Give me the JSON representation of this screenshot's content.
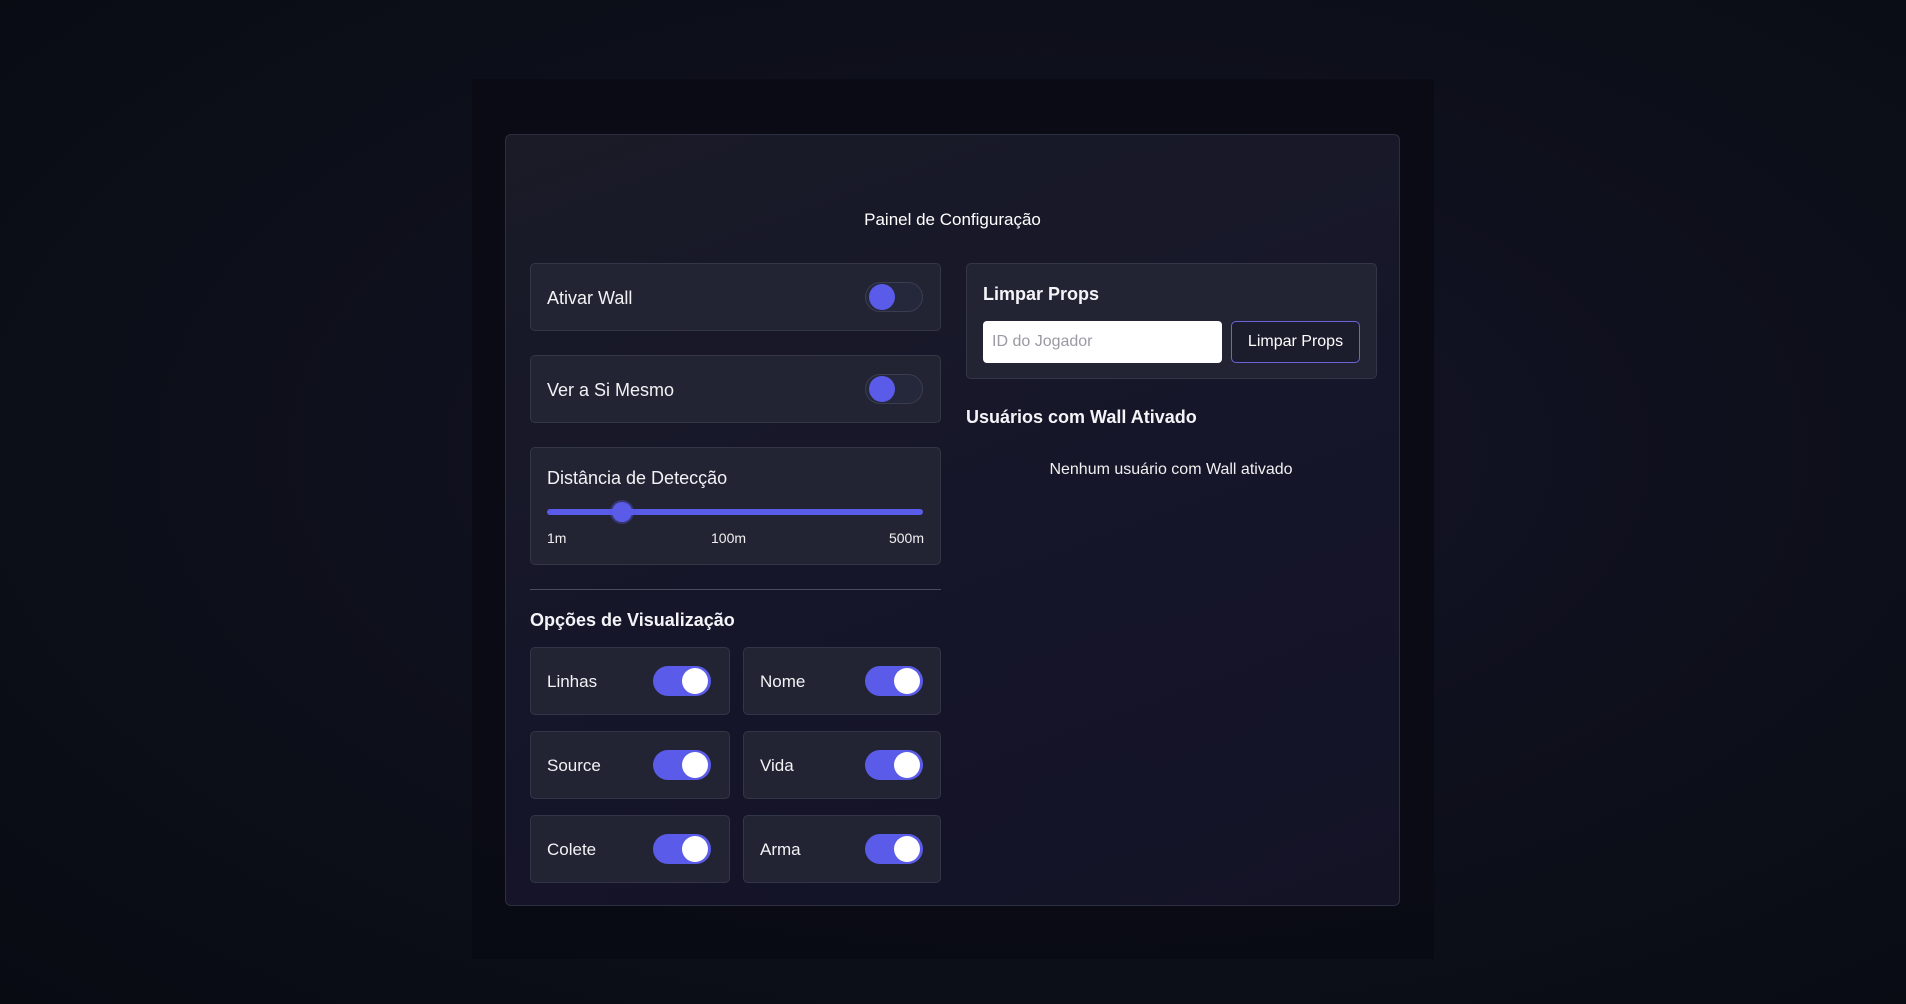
{
  "panel": {
    "title": "Painel de Configuração"
  },
  "settings": {
    "wall": {
      "label": "Ativar Wall",
      "enabled": false
    },
    "self_view": {
      "label": "Ver a Si Mesmo",
      "enabled": false
    },
    "distance": {
      "label": "Distância de Detecção",
      "min_label": "1m",
      "mid_label": "100m",
      "max_label": "500m",
      "min": 1,
      "max": 500,
      "value": 100
    }
  },
  "visual_options": {
    "title": "Opções de Visualização",
    "items": [
      {
        "label": "Linhas",
        "enabled": true
      },
      {
        "label": "Nome",
        "enabled": true
      },
      {
        "label": "Source",
        "enabled": true
      },
      {
        "label": "Vida",
        "enabled": true
      },
      {
        "label": "Colete",
        "enabled": true
      },
      {
        "label": "Arma",
        "enabled": true
      }
    ]
  },
  "clear_props": {
    "title": "Limpar Props",
    "input_placeholder": "ID do Jogador",
    "input_value": "",
    "button_label": "Limpar Props"
  },
  "wall_users": {
    "title": "Usuários com Wall Ativado",
    "empty_message": "Nenhum usuário com Wall ativado"
  },
  "colors": {
    "accent": "#5b5bea",
    "card_bg": "#222433",
    "panel_bg": "#1a1b27",
    "button_border": "#6b63d8"
  }
}
